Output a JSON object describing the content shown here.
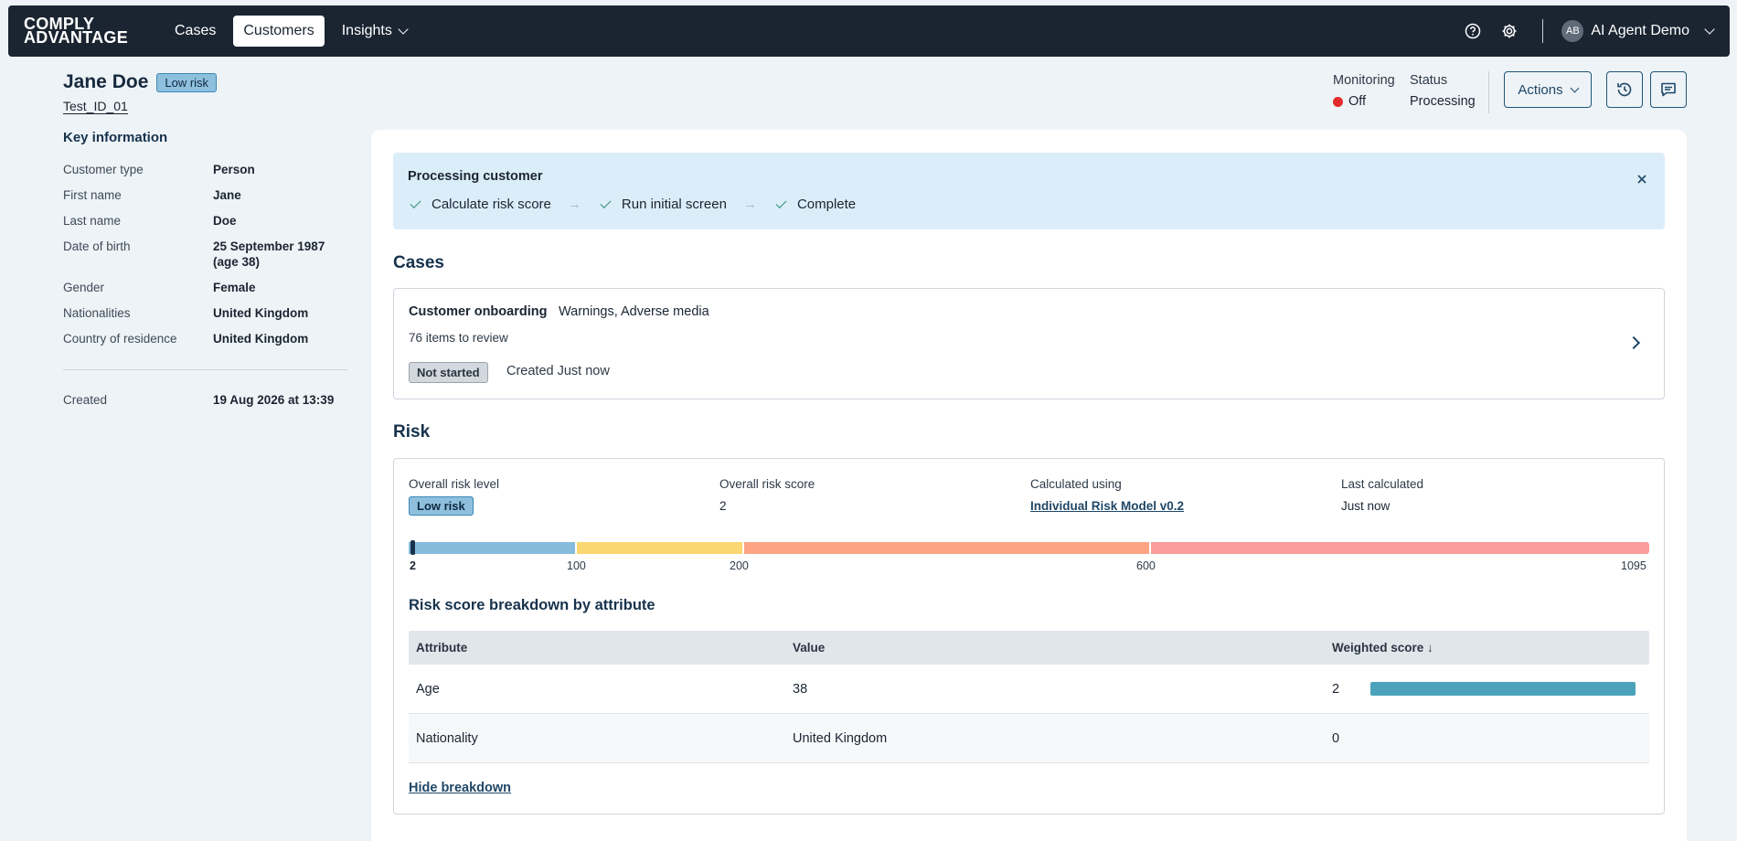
{
  "brand": {
    "line1": "COMPLY",
    "line2": "ADVANTAGE"
  },
  "nav": {
    "cases": "Cases",
    "customers": "Customers",
    "insights": "Insights"
  },
  "user": {
    "initials": "AB",
    "name": "AI Agent Demo"
  },
  "customer": {
    "name": "Jane Doe",
    "risk_badge": "Low risk",
    "id": "Test_ID_01"
  },
  "key_info": {
    "title": "Key information",
    "rows": [
      {
        "label": "Customer type",
        "value": "Person"
      },
      {
        "label": "First name",
        "value": "Jane"
      },
      {
        "label": "Last name",
        "value": "Doe"
      },
      {
        "label": "Date of birth",
        "value": "25 September 1987 (age 38)"
      },
      {
        "label": "Gender",
        "value": "Female"
      },
      {
        "label": "Nationalities",
        "value": "United Kingdom"
      },
      {
        "label": "Country of residence",
        "value": "United Kingdom"
      }
    ],
    "created_label": "Created",
    "created_value": "19 Aug 2026 at 13:39"
  },
  "header": {
    "monitoring_label": "Monitoring",
    "monitoring_value": "Off",
    "status_label": "Status",
    "status_value": "Processing",
    "actions_label": "Actions"
  },
  "banner": {
    "title": "Processing customer",
    "steps": [
      "Calculate risk score",
      "Run initial screen",
      "Complete"
    ],
    "arrow": "→"
  },
  "cases": {
    "title": "Cases",
    "case_title": "Customer onboarding",
    "case_tags": "Warnings, Adverse media",
    "count": "76 items to review",
    "status": "Not started",
    "created": "Created Just now"
  },
  "risk": {
    "title": "Risk",
    "level_label": "Overall risk level",
    "level_value": "Low risk",
    "score_label": "Overall risk score",
    "score_value": "2",
    "model_label": "Calculated using",
    "model_value": "Individual Risk Model v0.2",
    "last_label": "Last calculated",
    "last_value": "Just now",
    "scale_ticks": [
      "2",
      "100",
      "200",
      "600",
      "1095"
    ],
    "scale_colors": {
      "low": "#86bcdb",
      "medium": "#fbd772",
      "high": "#fda485",
      "very_high": "#fb9d9b"
    },
    "breakdown_title": "Risk score breakdown by attribute",
    "columns": {
      "attribute": "Attribute",
      "value": "Value",
      "weighted": "Weighted score ↓"
    },
    "rows": [
      {
        "attribute": "Age",
        "value": "38",
        "score": "2"
      },
      {
        "attribute": "Nationality",
        "value": "United Kingdom",
        "score": "0"
      }
    ],
    "hide_link": "Hide breakdown"
  }
}
